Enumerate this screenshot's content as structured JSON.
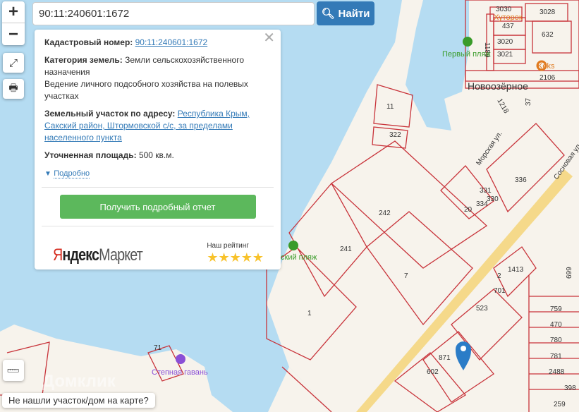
{
  "search": {
    "value": "90:11:240601:1672",
    "button": "Найти"
  },
  "controls": {
    "zoom_in": "+",
    "zoom_out": "−"
  },
  "popup": {
    "cad_label": "Кадастровый номер:",
    "cad_value": "90:11:240601:1672",
    "cat_label": "Категория земель:",
    "cat_value": "Земли сельскохозяйственного назначения",
    "use_value": "Ведение личного подсобного хозяйства на полевых участках",
    "addr_label": "Земельный участок по адресу:",
    "addr_value": "Республика Крым, Сакский район, Штормовской с/с, за пределами населенного пункта",
    "area_label": "Уточненная площадь:",
    "area_value": "500 кв.м.",
    "more": "Подробно",
    "report_button": "Получить подробный отчет",
    "ad": {
      "brand_1": "Я",
      "brand_2": "ндекс",
      "brand_3": "Маркет",
      "rating_label": "Наш рейтинг",
      "stars": 5
    }
  },
  "not_found": "Не нашли участок/дом на карте?",
  "watermark": "Домклик",
  "map": {
    "places": [
      "Хуторок",
      "Первый пляж",
      "Keks",
      "Новоозёрное",
      "Морская ул.",
      "Сосновая ул.",
      "ский пляж",
      "Степная гавань"
    ],
    "parcels": [
      "3030",
      "3028",
      "437",
      "632",
      "3020",
      "3021",
      "1189",
      "2106",
      "1218",
      "37",
      "11",
      "322",
      "242",
      "241",
      "7",
      "1",
      "20",
      "331",
      "330",
      "336",
      "334",
      "2",
      "1413",
      "701",
      "523",
      "699",
      "759",
      "470",
      "780",
      "781",
      "2488",
      "398",
      "259",
      "871",
      "602",
      "71"
    ]
  },
  "colors": {
    "water": "#b5dcf2",
    "land": "#f7f3ec",
    "parcel": "#c8333a",
    "accent": "#337ab7",
    "report": "#5cb85c"
  }
}
